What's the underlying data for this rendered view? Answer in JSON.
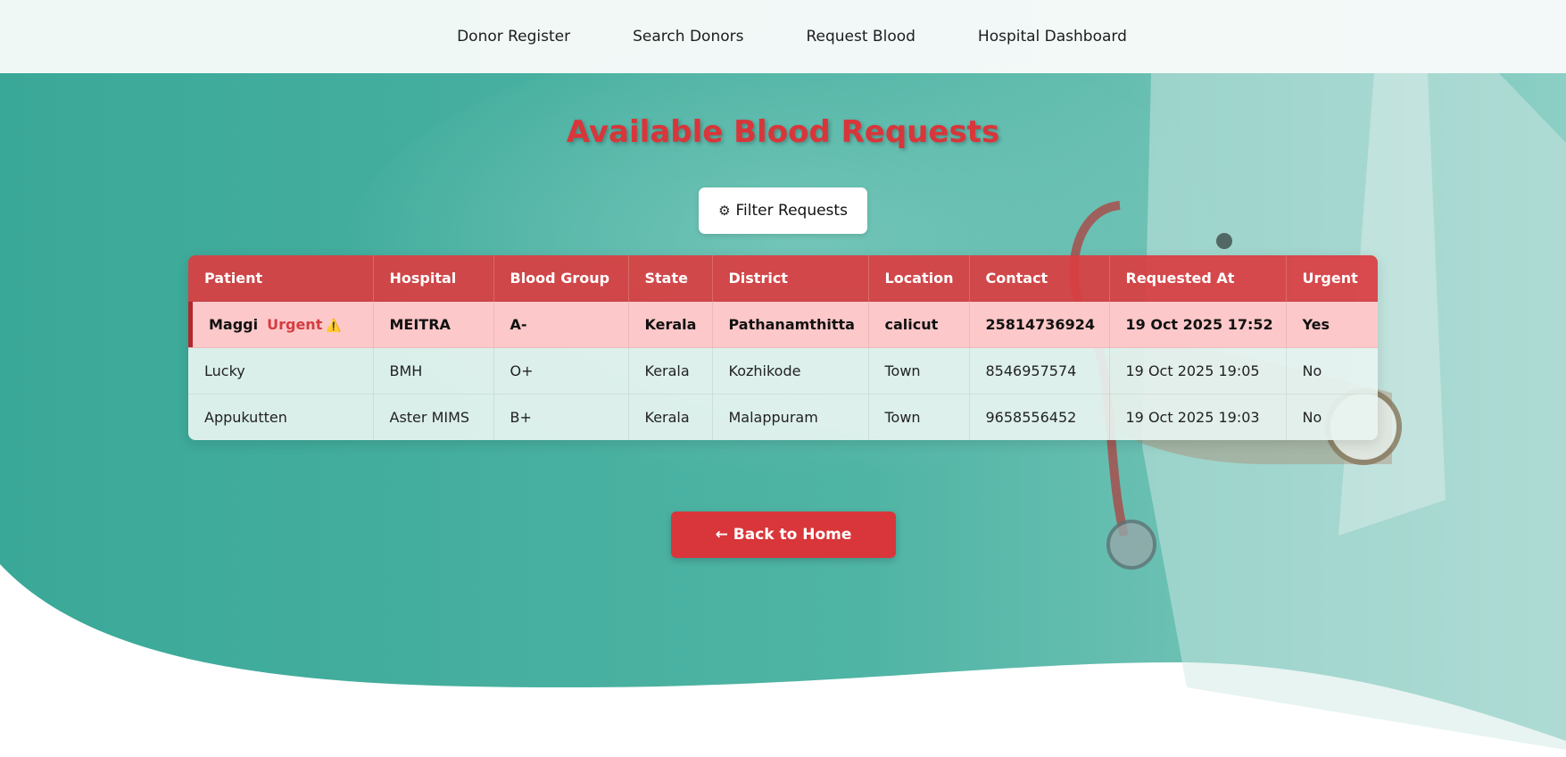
{
  "nav": {
    "items": [
      {
        "label": "Donor Register"
      },
      {
        "label": "Search Donors"
      },
      {
        "label": "Request Blood"
      },
      {
        "label": "Hospital Dashboard"
      }
    ]
  },
  "page": {
    "title": "Available Blood Requests"
  },
  "filter": {
    "icon": "gear-icon",
    "label": "Filter Requests"
  },
  "table": {
    "columns": [
      "Patient",
      "Hospital",
      "Blood Group",
      "State",
      "District",
      "Location",
      "Contact",
      "Requested At",
      "Urgent"
    ],
    "urgent_tag": "Urgent",
    "rows": [
      {
        "patient": "Maggi",
        "hospital": "MEITRA",
        "blood_group": "A-",
        "state": "Kerala",
        "district": "Pathanamthitta",
        "location": "calicut",
        "contact": "25814736924",
        "requested_at": "19 Oct 2025 17:52",
        "urgent": "Yes"
      },
      {
        "patient": "Lucky",
        "hospital": "BMH",
        "blood_group": "O+",
        "state": "Kerala",
        "district": "Kozhikode",
        "location": "Town",
        "contact": "8546957574",
        "requested_at": "19 Oct 2025 19:05",
        "urgent": "No"
      },
      {
        "patient": "Appukutten",
        "hospital": "Aster MIMS",
        "blood_group": "B+",
        "state": "Kerala",
        "district": "Malappuram",
        "location": "Town",
        "contact": "9658556452",
        "requested_at": "19 Oct 2025 19:03",
        "urgent": "No"
      }
    ]
  },
  "back_button": {
    "label": "← Back to Home"
  },
  "colors": {
    "accent_red": "#d8363a",
    "teal": "#4db3a2",
    "urgent_row": "#fdc8c9"
  }
}
